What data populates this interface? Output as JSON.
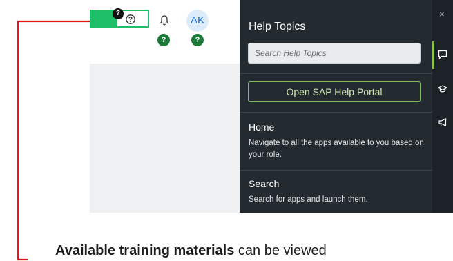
{
  "header": {
    "avatar_initials": "AK",
    "help_button_icon": "question-circle-icon",
    "bell_icon": "bell-icon",
    "badge_text": "?"
  },
  "help_panel": {
    "title": "Help Topics",
    "search_placeholder": "Search Help Topics",
    "portal_button_label": "Open SAP Help Portal",
    "topics": [
      {
        "title": "Home",
        "description": "Navigate to all the apps available to you based on your role."
      },
      {
        "title": "Search",
        "description": "Search for apps and launch them."
      }
    ],
    "close_label": "×",
    "rail_icons": [
      "speech-bubble-icon",
      "graduation-cap-icon",
      "megaphone-icon"
    ]
  },
  "annotation": {
    "caption_bold": "Available training materials",
    "caption_rest": " can be viewed"
  },
  "colors": {
    "highlight_green": "#1fbf6a",
    "panel_bg": "#232a30",
    "connector_red": "#e8141c",
    "badge_green": "#1a7a38"
  }
}
